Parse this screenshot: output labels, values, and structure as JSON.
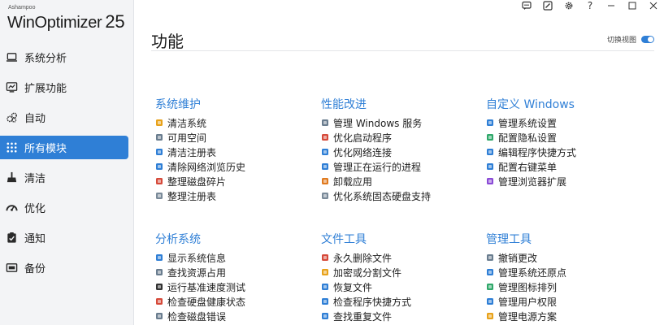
{
  "app": {
    "brand_small": "Ashampoo",
    "brand_name": "WinOptimizer",
    "version": "25"
  },
  "sidebar": {
    "items": [
      {
        "label": "系统分析",
        "icon": "laptop-icon"
      },
      {
        "label": "扩展功能",
        "icon": "dashboard-icon"
      },
      {
        "label": "自动",
        "icon": "gears-icon"
      },
      {
        "label": "所有模块",
        "icon": "grid-icon",
        "active": true
      },
      {
        "label": "清洁",
        "icon": "broom-icon"
      },
      {
        "label": "优化",
        "icon": "speedometer-icon"
      },
      {
        "label": "通知",
        "icon": "clipboard-check-icon"
      },
      {
        "label": "备份",
        "icon": "backup-icon"
      }
    ]
  },
  "titlebar": {
    "buttons": [
      "feedback-icon",
      "edit-icon",
      "gear-icon",
      "help-icon",
      "minimize-icon",
      "maximize-icon",
      "close-icon"
    ],
    "help": "?"
  },
  "main": {
    "title": "功能",
    "view_toggle_label": "切换视图",
    "colors": {
      "accent": "#2f7fd6"
    }
  },
  "groups": [
    {
      "title": "系统维护",
      "items": [
        {
          "label": "清洁系统",
          "color": "#e8a21a"
        },
        {
          "label": "可用空间",
          "color": "#6a7d8f"
        },
        {
          "label": "清洁注册表",
          "color": "#2f7fd6"
        },
        {
          "label": "清除网络浏览历史",
          "color": "#2f7fd6"
        },
        {
          "label": "整理磁盘碎片",
          "color": "#d64a3a"
        },
        {
          "label": "整理注册表",
          "color": "#7a8a99"
        }
      ]
    },
    {
      "title": "性能改进",
      "items": [
        {
          "label": "管理 Windows 服务",
          "color": "#6a7d8f"
        },
        {
          "label": "优化启动程序",
          "color": "#d64a3a"
        },
        {
          "label": "优化网络连接",
          "color": "#2f7fd6"
        },
        {
          "label": "管理正在运行的进程",
          "color": "#2f7fd6"
        },
        {
          "label": "卸载应用",
          "color": "#e07a1f"
        },
        {
          "label": "优化系统固态硬盘支持",
          "color": "#7a8a99"
        }
      ]
    },
    {
      "title": "自定义 Windows",
      "items": [
        {
          "label": "管理系统设置",
          "color": "#2f7fd6"
        },
        {
          "label": "配置隐私设置",
          "color": "#2fa86a"
        },
        {
          "label": "编辑程序快捷方式",
          "color": "#2f7fd6"
        },
        {
          "label": "配置右键菜单",
          "color": "#2f7fd6"
        },
        {
          "label": "管理浏览器扩展",
          "color": "#8a4ad6"
        }
      ]
    },
    {
      "title": "分析系统",
      "items": [
        {
          "label": "显示系统信息",
          "color": "#2f7fd6"
        },
        {
          "label": "查找资源占用",
          "color": "#6a7d8f"
        },
        {
          "label": "运行基准速度测试",
          "color": "#333333"
        },
        {
          "label": "检查硬盘健康状态",
          "color": "#d64a3a"
        },
        {
          "label": "检查磁盘错误",
          "color": "#6a7d8f"
        }
      ]
    },
    {
      "title": "文件工具",
      "items": [
        {
          "label": "永久删除文件",
          "color": "#d64a3a"
        },
        {
          "label": "加密或分割文件",
          "color": "#e8a21a"
        },
        {
          "label": "恢复文件",
          "color": "#2f7fd6"
        },
        {
          "label": "检查程序快捷方式",
          "color": "#2f7fd6"
        },
        {
          "label": "查找重复文件",
          "color": "#2f7fd6"
        }
      ]
    },
    {
      "title": "管理工具",
      "items": [
        {
          "label": "撤销更改",
          "color": "#6a7d8f"
        },
        {
          "label": "管理系统还原点",
          "color": "#2f7fd6"
        },
        {
          "label": "管理图标排列",
          "color": "#2fa86a"
        },
        {
          "label": "管理用户权限",
          "color": "#2f7fd6"
        },
        {
          "label": "管理电源方案",
          "color": "#e8a21a"
        }
      ]
    }
  ]
}
